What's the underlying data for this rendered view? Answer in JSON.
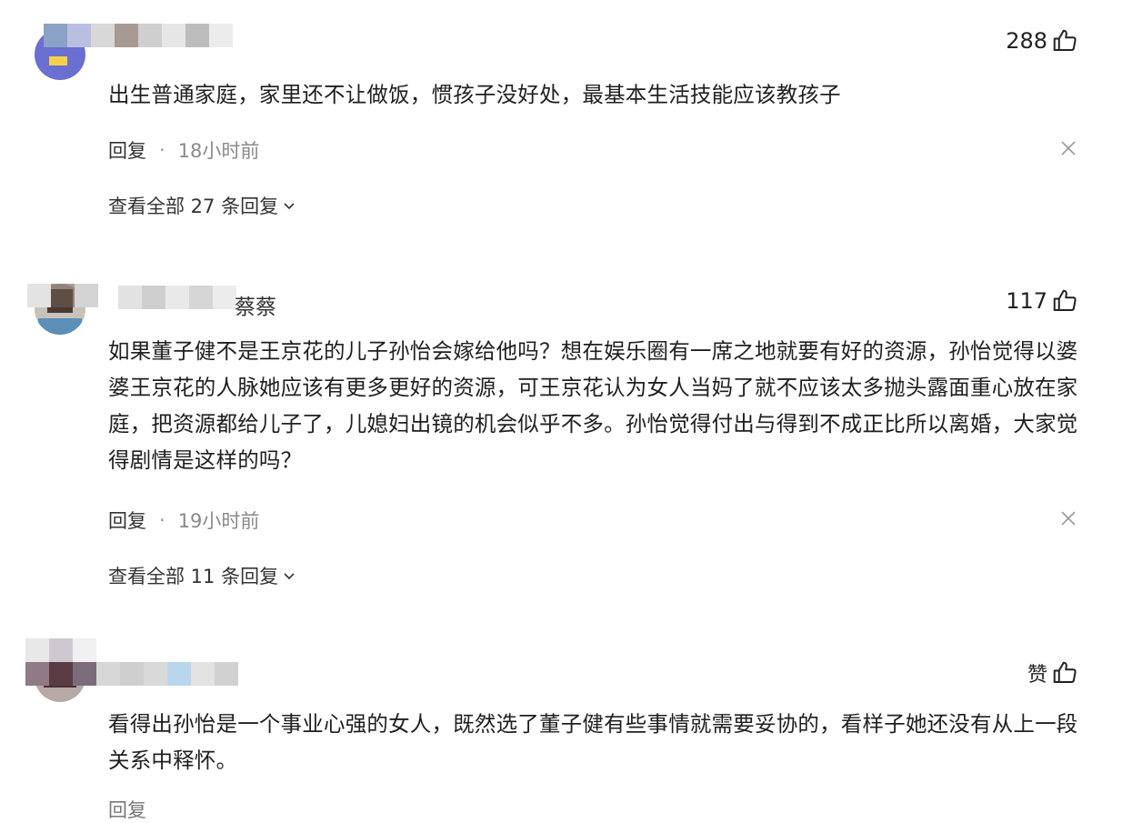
{
  "comments": [
    {
      "username": "",
      "likes": "288",
      "text": "出生普通家庭，家里还不让做饭，惯孩子没好处，最基本生活技能应该教孩子",
      "reply_label": "回复",
      "separator": "·",
      "time": "18小时前",
      "view_all": "查看全部 27 条回复"
    },
    {
      "username": "蔡蔡",
      "likes": "117",
      "text": "如果董子健不是王京花的儿子孙怡会嫁给他吗？想在娱乐圈有一席之地就要有好的资源，孙怡觉得以婆婆王京花的人脉她应该有更多更好的资源，可王京花认为女人当妈了就不应该太多抛头露面重心放在家庭，把资源都给儿子了，儿媳妇出镜的机会似乎不多。孙怡觉得付出与得到不成正比所以离婚，大家觉得剧情是这样的吗？",
      "reply_label": "回复",
      "separator": "·",
      "time": "19小时前",
      "view_all": "查看全部 11 条回复"
    },
    {
      "username": "",
      "likes": "赞",
      "text": "看得出孙怡是一个事业心强的女人，既然选了董子健有些事情就需要妥协的，看样子她还没有从上一段关系中释怀。",
      "reply_label": "回复"
    }
  ],
  "icons": {
    "like": "thumbs-up-icon",
    "close": "close-icon",
    "expand": "chevron-down-icon"
  },
  "colors": {
    "text": "#1f1f1f",
    "meta": "#8a8a8a",
    "background": "#ffffff"
  }
}
